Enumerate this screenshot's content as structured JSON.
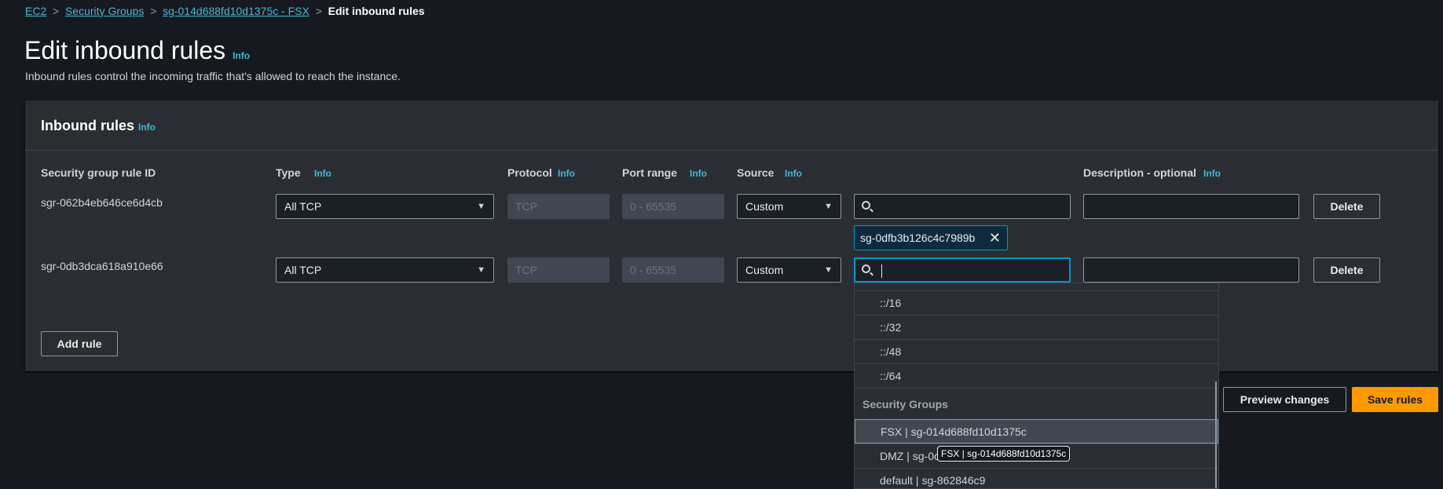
{
  "breadcrumb": [
    {
      "label": "EC2"
    },
    {
      "label": "Security Groups"
    },
    {
      "label": "sg-014d688fd10d1375c - FSX"
    },
    {
      "label": "Edit inbound rules"
    }
  ],
  "page": {
    "title": "Edit inbound rules",
    "info": "Info",
    "description": "Inbound rules control the incoming traffic that's allowed to reach the instance."
  },
  "panel": {
    "title": "Inbound rules",
    "info": "Info",
    "columns": {
      "rule_id": "Security group rule ID",
      "type": "Type",
      "protocol": "Protocol",
      "port_range": "Port range",
      "source": "Source",
      "description": "Description - optional",
      "info": "Info"
    },
    "rows": [
      {
        "rule_id": "sgr-062b4eb646ce6d4cb",
        "type": "All TCP",
        "protocol": "TCP",
        "port_range": "0 - 65535",
        "source": "Custom",
        "search": "",
        "description": "",
        "delete": "Delete",
        "token": "sg-0dfb3b126c4c7989b"
      },
      {
        "rule_id": "sgr-0db3dca618a910e66",
        "type": "All TCP",
        "protocol": "TCP",
        "port_range": "0 - 65535",
        "source": "Custom",
        "search": "",
        "description": "",
        "delete": "Delete"
      }
    ],
    "add_rule": "Add rule"
  },
  "dropdown": {
    "options": [
      "::/16",
      "::/32",
      "::/48",
      "::/64"
    ],
    "group_header": "Security Groups",
    "groups": [
      "FSX | sg-014d688fd10d1375c",
      "DMZ | sg-0c",
      "default | sg-862846c9"
    ],
    "tooltip": "FSX | sg-014d688fd10d1375c"
  },
  "actions": {
    "preview": "Preview changes",
    "save": "Save rules"
  },
  "colors": {
    "accent": "#ff9900",
    "link": "#44b9d6",
    "focus": "#0099cc"
  }
}
